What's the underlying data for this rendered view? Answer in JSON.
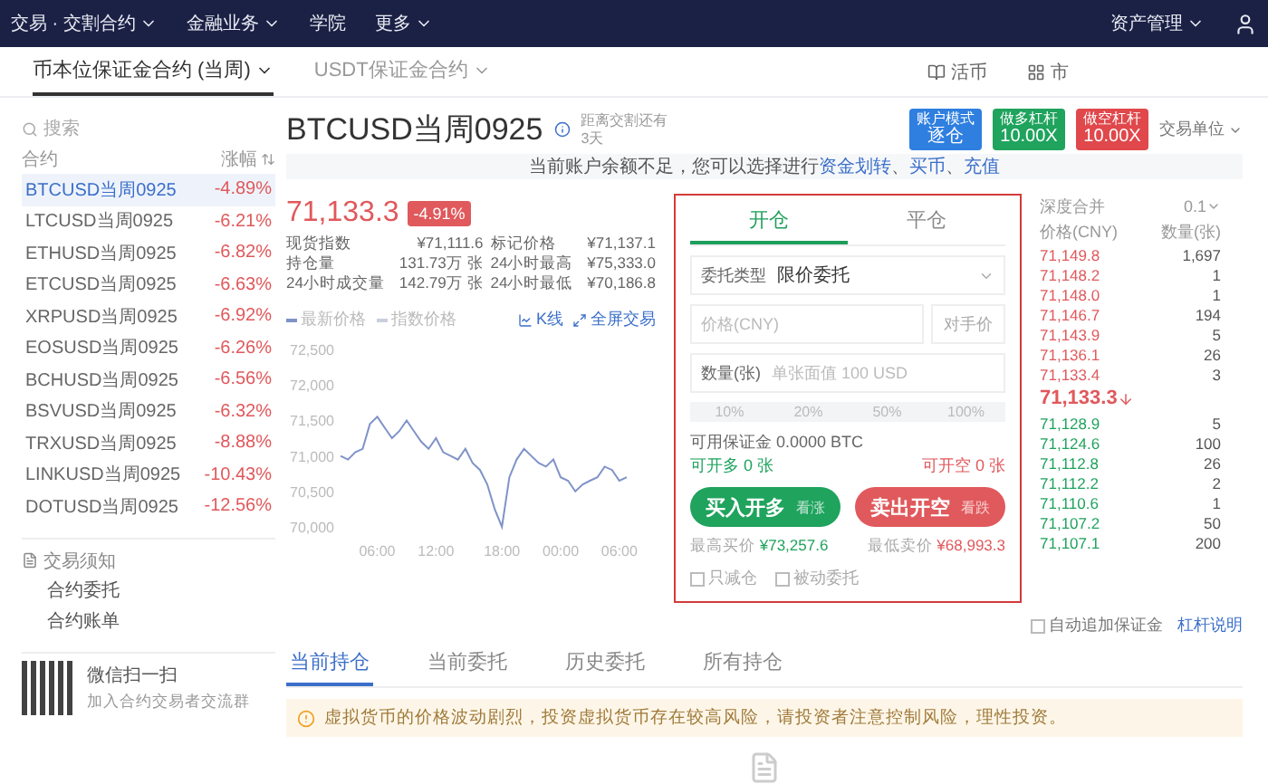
{
  "top_nav": {
    "items": [
      {
        "label": "交易 · 交割合约",
        "dropdown": true
      },
      {
        "label": "金融业务",
        "dropdown": true
      },
      {
        "label": "学院",
        "dropdown": false
      },
      {
        "label": "更多",
        "dropdown": true
      }
    ],
    "account": "资产管理"
  },
  "sub_nav": {
    "tabs": [
      {
        "label": "币本位保证金合约 (当周)",
        "selected": true
      },
      {
        "label": "USDT保证金合约",
        "selected": false
      }
    ],
    "links": [
      "活币",
      "市"
    ]
  },
  "sidebar": {
    "search_placeholder": "搜索",
    "columns": [
      "合约",
      "涨幅"
    ],
    "contracts": [
      {
        "name": "BTCUSD当周0925",
        "change": "-4.89%",
        "selected": true
      },
      {
        "name": "LTCUSD当周0925",
        "change": "-6.21%",
        "selected": false
      },
      {
        "name": "ETHUSD当周0925",
        "change": "-6.82%",
        "selected": false
      },
      {
        "name": "ETCUSD当周0925",
        "change": "-6.63%",
        "selected": false
      },
      {
        "name": "XRPUSD当周0925",
        "change": "-6.92%",
        "selected": false
      },
      {
        "name": "EOSUSD当周0925",
        "change": "-6.26%",
        "selected": false
      },
      {
        "name": "BCHUSD当周0925",
        "change": "-6.56%",
        "selected": false
      },
      {
        "name": "BSVUSD当周0925",
        "change": "-6.32%",
        "selected": false
      },
      {
        "name": "TRXUSD当周0925",
        "change": "-8.88%",
        "selected": false
      },
      {
        "name": "LINKUSD当周0925",
        "change": "-10.43%",
        "selected": false
      },
      {
        "name": "DOTUSD当周0925",
        "change": "-12.56%",
        "selected": false
      }
    ],
    "section": {
      "title": "交易须知",
      "items": [
        "合约委托",
        "合约账单"
      ]
    },
    "qr": {
      "title": "微信扫一扫",
      "subtitle": "加入合约交易者交流群"
    }
  },
  "contract": {
    "title": "BTCUSD当周0925",
    "delivery": "距离交割还有",
    "delivery_days": "3天",
    "modes": [
      {
        "kind": "mode",
        "label": "账户模式",
        "value": "逐仓"
      },
      {
        "kind": "long",
        "label": "做多杠杆",
        "value": "10.00X"
      },
      {
        "kind": "short",
        "label": "做空杠杆",
        "value": "10.00X"
      }
    ],
    "unit_label": "交易单位"
  },
  "notice": [
    {
      "text": "当前账户余额不足，您可以选择进行",
      "link": false
    },
    {
      "text": "资金划转",
      "link": true
    },
    {
      "text": "、",
      "link": false
    },
    {
      "text": "买币",
      "link": true
    },
    {
      "text": "、",
      "link": false
    },
    {
      "text": "充值",
      "link": true
    }
  ],
  "ticker": {
    "price": "71,133.3",
    "change": "-4.91%",
    "stats": [
      {
        "label": "现货指数",
        "value": "¥71,111.6"
      },
      {
        "label": "标记价格",
        "value": "¥71,137.1"
      },
      {
        "label": "持仓量",
        "value": "131.73万 张"
      },
      {
        "label": "24小时最高",
        "value": "¥75,333.0"
      },
      {
        "label": "24小时成交量",
        "value": "142.79万 张"
      },
      {
        "label": "24小时最低",
        "value": "¥70,186.8"
      }
    ]
  },
  "chart": {
    "links": [
      "K线",
      "全屏交易"
    ],
    "chart_data": {
      "type": "line",
      "categories": [
        null,
        null,
        null,
        null,
        null,
        "06:00",
        null,
        null,
        null,
        null,
        null,
        null,
        null,
        "12:00",
        null,
        null,
        null,
        null,
        null,
        null,
        null,
        null,
        "18:00",
        null,
        null,
        null,
        null,
        null,
        null,
        null,
        "00:00",
        null,
        null,
        null,
        null,
        null,
        null,
        null,
        "06:00",
        null
      ],
      "series": [
        {
          "name": "最新价格",
          "color": "#7f93c8",
          "values": [
            71000,
            70950,
            71050,
            71100,
            71450,
            71550,
            71400,
            71250,
            71350,
            71500,
            71350,
            71200,
            71100,
            71250,
            71050,
            71000,
            70950,
            71100,
            70900,
            70800,
            70600,
            70250,
            70000,
            70700,
            70950,
            71100,
            71000,
            70900,
            70850,
            70950,
            70700,
            70650,
            70500,
            70600,
            70650,
            70700,
            70850,
            70800,
            70650,
            70700
          ]
        },
        {
          "name": "指数价格",
          "color": "#c9cfdc",
          "values": [
            null,
            null,
            null,
            null,
            null,
            null,
            null,
            null,
            null,
            null,
            null,
            null,
            null,
            null,
            null,
            null,
            null,
            null,
            null,
            null,
            null,
            null,
            null,
            null,
            null,
            null,
            null,
            null,
            null,
            null,
            null,
            null,
            null,
            null,
            null,
            null,
            null,
            null,
            null,
            null
          ]
        }
      ],
      "ylim": [
        70000,
        72500
      ],
      "yticks": [
        {
          "value": 72500,
          "label": "72,500"
        },
        {
          "value": 72000,
          "label": "72,000"
        },
        {
          "value": 71500,
          "label": "71,500"
        },
        {
          "value": 71000,
          "label": "71,000"
        },
        {
          "value": 70500,
          "label": "70,500"
        },
        {
          "value": 70000,
          "label": "70,000"
        }
      ]
    }
  },
  "order_form": {
    "tabs": [
      {
        "label": "开仓",
        "selected": true
      },
      {
        "label": "平仓",
        "selected": false
      }
    ],
    "type_label": "委托类型",
    "type_value": "限价委托",
    "price_placeholder": "价格(CNY)",
    "counter_price": "对手价",
    "qty_label": "数量(张)",
    "qty_placeholder": "单张面值 100 USD",
    "percents": [
      "10%",
      "20%",
      "50%",
      "100%"
    ],
    "available": "可用保证金 0.0000 BTC",
    "can_long": "可开多 0 张",
    "can_short": "可开空 0 张",
    "buttons": [
      {
        "kind": "buy",
        "label": "买入开多",
        "hint": "看涨"
      },
      {
        "kind": "sell",
        "label": "卖出开空",
        "hint": "看跌"
      }
    ],
    "estimates": [
      {
        "kind": "buy",
        "label": "最高买价",
        "value": "¥73,257.6"
      },
      {
        "kind": "sell",
        "label": "最低卖价",
        "value": "¥68,993.3"
      }
    ],
    "options": [
      {
        "label": "只减仓",
        "checked": false
      },
      {
        "label": "被动委托",
        "checked": false
      }
    ]
  },
  "order_book": {
    "depth_label": "深度合并",
    "depth_value": "0.1",
    "columns": [
      "价格(CNY)",
      "数量(张)"
    ],
    "asks": [
      {
        "price": "71,149.8",
        "qty": "1,697"
      },
      {
        "price": "71,148.2",
        "qty": "1"
      },
      {
        "price": "71,148.0",
        "qty": "1"
      },
      {
        "price": "71,146.7",
        "qty": "194"
      },
      {
        "price": "71,143.9",
        "qty": "5"
      },
      {
        "price": "71,136.1",
        "qty": "26"
      },
      {
        "price": "71,133.4",
        "qty": "3"
      }
    ],
    "last": "71,133.3",
    "bids": [
      {
        "price": "71,128.9",
        "qty": "5"
      },
      {
        "price": "71,124.6",
        "qty": "100"
      },
      {
        "price": "71,112.8",
        "qty": "26"
      },
      {
        "price": "71,112.2",
        "qty": "2"
      },
      {
        "price": "71,110.6",
        "qty": "1"
      },
      {
        "price": "71,107.2",
        "qty": "50"
      },
      {
        "price": "71,107.1",
        "qty": "200"
      }
    ],
    "auto_margin": {
      "label": "自动追加保证金",
      "checked": false
    },
    "guide_link": "杠杆说明"
  },
  "positions": {
    "tabs": [
      {
        "label": "当前持仓",
        "selected": true
      },
      {
        "label": "当前委托",
        "selected": false
      },
      {
        "label": "历史委托",
        "selected": false
      },
      {
        "label": "所有持仓",
        "selected": false
      }
    ],
    "warning": "虚拟货币的价格波动剧烈，投资虚拟货币存在较高风险，请投资者注意控制风险，理性投资。"
  }
}
